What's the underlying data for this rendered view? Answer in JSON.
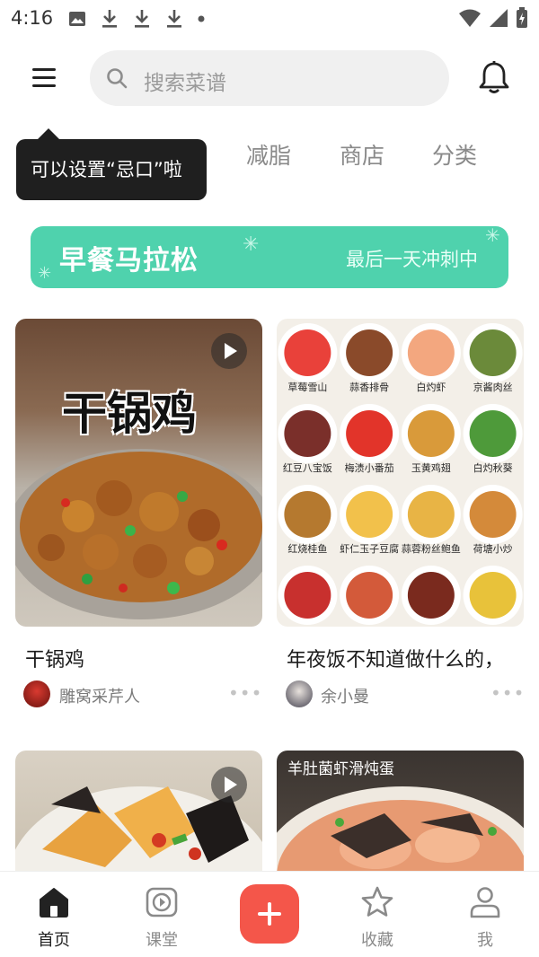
{
  "status_bar": {
    "time": "4:16"
  },
  "header": {
    "search_placeholder": "搜索菜谱"
  },
  "tabs": [
    "减脂",
    "商店",
    "分类"
  ],
  "tooltip": "可以设置“忌口”啦",
  "banner": {
    "title": "早餐马拉松",
    "subtitle": "最后一天冲刺中"
  },
  "feed": [
    {
      "title": "干锅鸡",
      "author": "雕窝采芹人",
      "overlay_text": "干锅鸡",
      "has_video": true
    },
    {
      "title": "年夜饭不知道做什么的，",
      "author": "余小曼",
      "has_video": false,
      "dish_labels": [
        "草莓雪山",
        "蒜香排骨",
        "白灼虾",
        "京酱肉丝",
        "红豆八宝饭",
        "梅渍小番茄",
        "玉黄鸡翅",
        "白灼秋葵",
        "红烧桂鱼",
        "虾仁玉子豆腐",
        "蒜蓉粉丝鲍鱼",
        "荷塘小炒"
      ]
    },
    {
      "title": "",
      "author": "",
      "has_video": true
    },
    {
      "title": "",
      "author": "",
      "overlay_text": "羊肚菌虾滑炖蛋",
      "has_video": false
    }
  ],
  "tabbar": [
    {
      "label": "首页",
      "icon": "home-icon",
      "active": true
    },
    {
      "label": "课堂",
      "icon": "play-icon",
      "active": false
    },
    {
      "label": "",
      "icon": "plus-icon",
      "active": false
    },
    {
      "label": "收藏",
      "icon": "star-icon",
      "active": false
    },
    {
      "label": "我",
      "icon": "person-icon",
      "active": false
    }
  ],
  "colors": {
    "banner": "#4fd2ad",
    "accent": "#f4564a"
  }
}
